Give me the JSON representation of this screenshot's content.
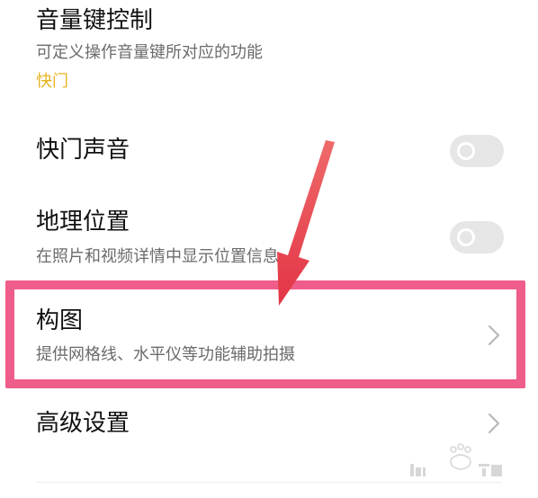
{
  "settings": {
    "volume_key": {
      "title": "音量键控制",
      "subtitle": "可定义操作音量键所对应的功能",
      "value": "快门"
    },
    "shutter_sound": {
      "title": "快门声音",
      "enabled": false
    },
    "location": {
      "title": "地理位置",
      "subtitle": "在照片和视频详情中显示位置信息",
      "enabled": false
    },
    "composition": {
      "title": "构图",
      "subtitle": "提供网格线、水平仪等功能辅助拍摄"
    },
    "advanced": {
      "title": "高级设置"
    }
  },
  "colors": {
    "accent": "#e6b21e",
    "highlight_border": "#ef5d8a",
    "annotation_arrow": "#ea3f4d",
    "toggle_off": "#e6e6e6"
  },
  "icons": [
    "chevron-right-icon",
    "toggle-knob-icon"
  ]
}
